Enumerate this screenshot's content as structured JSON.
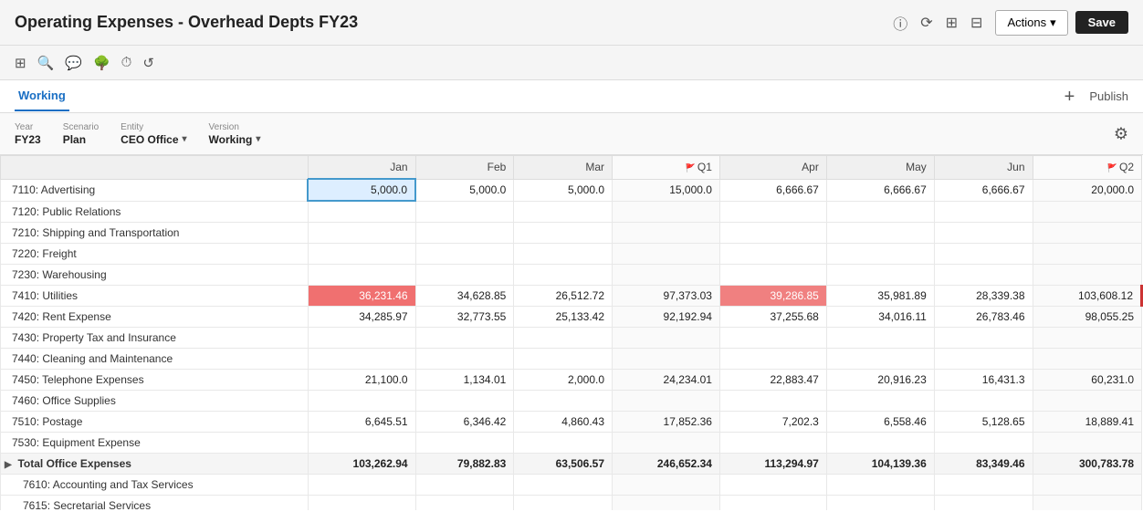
{
  "header": {
    "title": "Operating Expenses - Overhead Depts FY23",
    "actions_label": "Actions",
    "save_label": "Save"
  },
  "toolbar": {
    "icons": [
      "filter-icon",
      "search-icon",
      "comment-icon",
      "hierarchy-icon",
      "history-icon",
      "undo-icon"
    ]
  },
  "tabs": [
    {
      "label": "Working",
      "active": true
    }
  ],
  "tab_actions": {
    "add": "+",
    "publish": "Publish"
  },
  "filters": {
    "year_label": "Year",
    "year_value": "FY23",
    "scenario_label": "Scenario",
    "scenario_value": "Plan",
    "entity_label": "Entity",
    "entity_value": "CEO Office",
    "version_label": "Version",
    "version_value": "Working"
  },
  "table": {
    "columns": [
      "",
      "Jan",
      "Feb",
      "Mar",
      "Q1",
      "Apr",
      "May",
      "Jun",
      "Q2"
    ],
    "rows": [
      {
        "label": "7110: Advertising",
        "indent": false,
        "values": [
          "5,000.0",
          "5,000.0",
          "5,000.0",
          "15,000.0",
          "6,666.67",
          "6,666.67",
          "6,666.67",
          "20,000.0"
        ],
        "highlight_jan": true
      },
      {
        "label": "7120: Public Relations",
        "indent": false,
        "values": [
          "",
          "",
          "",
          "",
          "",
          "",
          "",
          ""
        ]
      },
      {
        "label": "7210: Shipping and Transportation",
        "indent": false,
        "values": [
          "",
          "",
          "",
          "",
          "",
          "",
          "",
          ""
        ]
      },
      {
        "label": "7220: Freight",
        "indent": false,
        "values": [
          "",
          "",
          "",
          "",
          "",
          "",
          "",
          ""
        ]
      },
      {
        "label": "7230: Warehousing",
        "indent": false,
        "values": [
          "",
          "",
          "",
          "",
          "",
          "",
          "",
          ""
        ]
      },
      {
        "label": "7410: Utilities",
        "indent": false,
        "values": [
          "36,231.46",
          "34,628.85",
          "26,512.72",
          "97,373.03",
          "39,286.85",
          "35,981.89",
          "28,339.38",
          "103,608.12"
        ],
        "red_jan": true,
        "red_apr": true,
        "red_q2_flag": true
      },
      {
        "label": "7420: Rent Expense",
        "indent": false,
        "values": [
          "34,285.97",
          "32,773.55",
          "25,133.42",
          "92,192.94",
          "37,255.68",
          "34,016.11",
          "26,783.46",
          "98,055.25"
        ]
      },
      {
        "label": "7430: Property Tax and Insurance",
        "indent": false,
        "values": [
          "",
          "",
          "",
          "",
          "",
          "",
          "",
          ""
        ]
      },
      {
        "label": "7440: Cleaning and Maintenance",
        "indent": false,
        "values": [
          "",
          "",
          "",
          "",
          "",
          "",
          "",
          ""
        ]
      },
      {
        "label": "7450: Telephone Expenses",
        "indent": false,
        "values": [
          "21,100.0",
          "1,134.01",
          "2,000.0",
          "24,234.01",
          "22,883.47",
          "20,916.23",
          "16,431.3",
          "60,231.0"
        ]
      },
      {
        "label": "7460: Office Supplies",
        "indent": false,
        "values": [
          "",
          "",
          "",
          "",
          "",
          "",
          "",
          ""
        ]
      },
      {
        "label": "7510: Postage",
        "indent": false,
        "values": [
          "6,645.51",
          "6,346.42",
          "4,860.43",
          "17,852.36",
          "7,202.3",
          "6,558.46",
          "5,128.65",
          "18,889.41"
        ]
      },
      {
        "label": "7530: Equipment Expense",
        "indent": false,
        "values": [
          "",
          "",
          "",
          "",
          "",
          "",
          "",
          ""
        ]
      },
      {
        "label": "Total Office Expenses",
        "indent": false,
        "total": true,
        "values": [
          "103,262.94",
          "79,882.83",
          "63,506.57",
          "246,652.34",
          "113,294.97",
          "104,139.36",
          "83,349.46",
          "300,783.78"
        ]
      },
      {
        "label": "7610: Accounting and Tax Services",
        "indent": true,
        "values": [
          "",
          "",
          "",
          "",
          "",
          "",
          "",
          ""
        ]
      },
      {
        "label": "7615: Secretarial Services",
        "indent": true,
        "values": [
          "",
          "",
          "",
          "",
          "",
          "",
          "",
          ""
        ]
      }
    ]
  }
}
